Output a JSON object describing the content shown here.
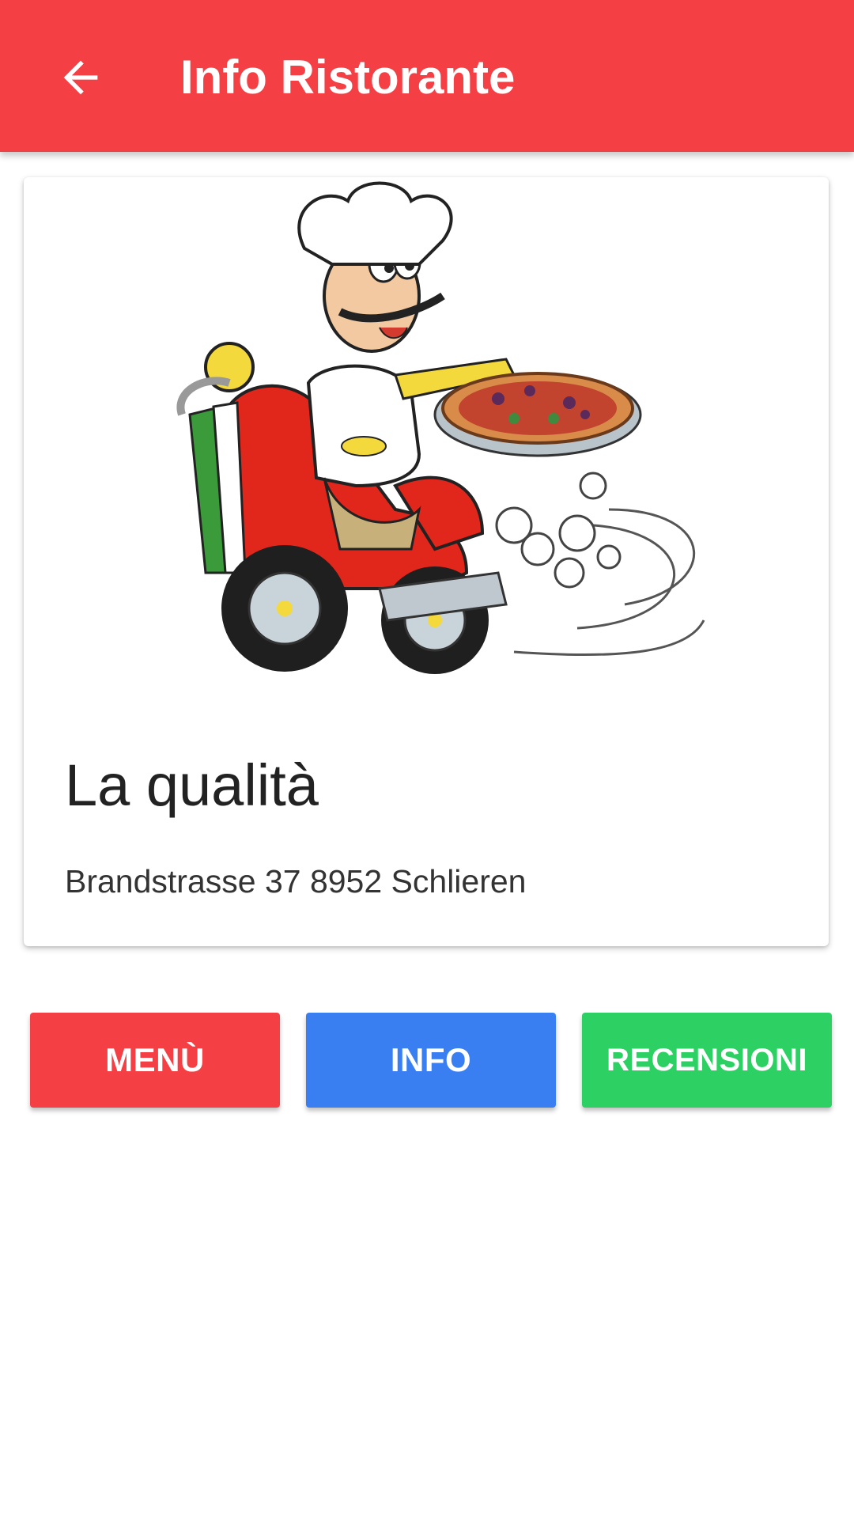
{
  "colors": {
    "toolbar": "#F43F45",
    "menu_button": "#F43F45",
    "info_button": "#3A7FF2",
    "reviews_button": "#2DD163",
    "title_text": "#222222",
    "address_text": "#333333"
  },
  "toolbar": {
    "back_icon": "arrow-left-icon",
    "title": "Info Ristorante"
  },
  "restaurant": {
    "image": "pizza-delivery-chef-on-scooter-illustration",
    "name": "La qualità",
    "address": "Brandstrasse 37 8952 Schlieren"
  },
  "actions": {
    "menu_label": "MENÙ",
    "info_label": "INFO",
    "reviews_label": "RECENSIONI"
  }
}
